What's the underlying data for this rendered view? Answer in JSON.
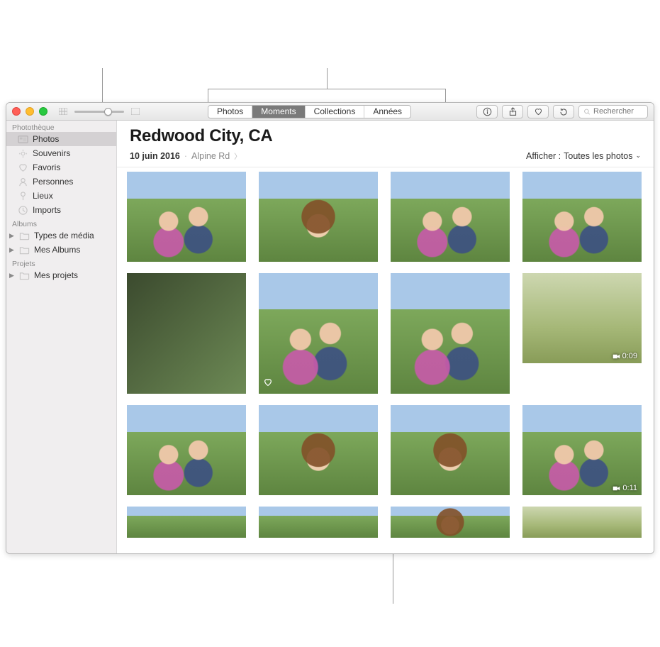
{
  "toolbar": {
    "tabs": [
      "Photos",
      "Moments",
      "Collections",
      "Années"
    ],
    "active_tab_index": 1,
    "search_placeholder": "Rechercher"
  },
  "sidebar": {
    "sections": [
      {
        "title": "Photothèque",
        "items": [
          {
            "label": "Photos",
            "icon": "photos-icon",
            "selected": true
          },
          {
            "label": "Souvenirs",
            "icon": "memories-icon"
          },
          {
            "label": "Favoris",
            "icon": "heart-icon"
          },
          {
            "label": "Personnes",
            "icon": "person-icon"
          },
          {
            "label": "Lieux",
            "icon": "pin-icon"
          },
          {
            "label": "Imports",
            "icon": "clock-icon"
          }
        ]
      },
      {
        "title": "Albums",
        "items": [
          {
            "label": "Types de média",
            "icon": "folder-icon",
            "disclosure": true
          },
          {
            "label": "Mes Albums",
            "icon": "folder-icon",
            "disclosure": true
          }
        ]
      },
      {
        "title": "Projets",
        "items": [
          {
            "label": "Mes projets",
            "icon": "folder-icon",
            "disclosure": true
          }
        ]
      }
    ]
  },
  "header": {
    "title": "Redwood City, CA",
    "date": "10 juin 2016",
    "location": "Alpine Rd",
    "filter_prefix": "Afficher :",
    "filter_value": "Toutes les photos"
  },
  "grid": {
    "rows": [
      [
        {
          "scene": "people",
          "orient": "land"
        },
        {
          "scene": "kid",
          "orient": "land"
        },
        {
          "scene": "people",
          "orient": "land"
        },
        {
          "scene": "people",
          "orient": "land"
        }
      ],
      [
        {
          "scene": "dark",
          "orient": "port"
        },
        {
          "scene": "people",
          "orient": "port",
          "favorite": true
        },
        {
          "scene": "people",
          "orient": "port"
        },
        {
          "scene": "grass",
          "orient": "land",
          "video_duration": "0:09"
        }
      ],
      [
        {
          "scene": "people",
          "orient": "land"
        },
        {
          "scene": "kid",
          "orient": "land"
        },
        {
          "scene": "kid",
          "orient": "land"
        },
        {
          "scene": "people",
          "orient": "land",
          "video_duration": "0:11"
        }
      ],
      [
        {
          "scene": "green",
          "orient": "land",
          "cut": true
        },
        {
          "scene": "green",
          "orient": "land",
          "cut": true
        },
        {
          "scene": "kid",
          "orient": "land",
          "cut": true
        },
        {
          "scene": "grass",
          "orient": "land",
          "cut": true
        }
      ]
    ]
  }
}
